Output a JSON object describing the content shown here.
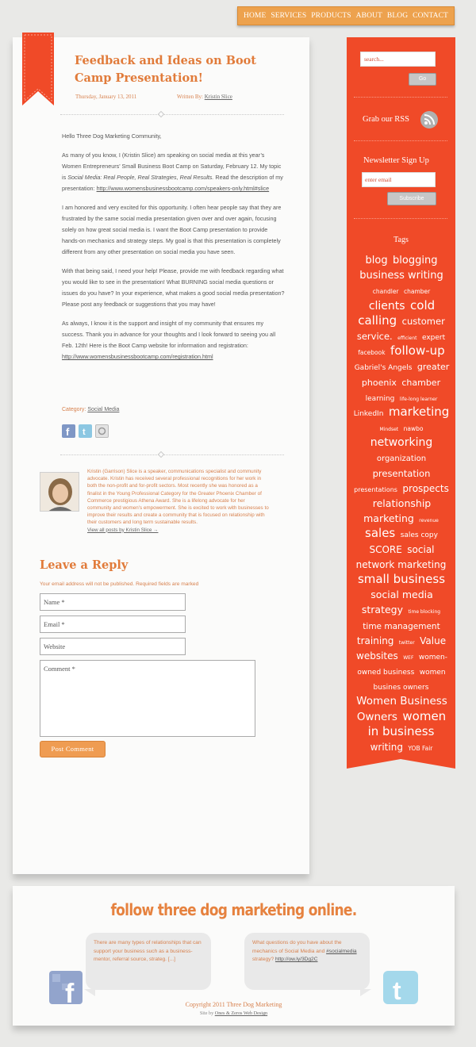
{
  "nav": {
    "items": [
      "HOME",
      "SERVICES",
      "PRODUCTS",
      "ABOUT",
      "BLOG",
      "CONTACT"
    ]
  },
  "post": {
    "title": "Feedback and Ideas on Boot Camp Presentation!",
    "date": "Thursday, January 13, 2011",
    "written_by_label": "Written By:",
    "author": "Kristin Slice",
    "p1": "Hello Three Dog Marketing Community,",
    "p2_a": "As many of you know, I (Kristin Slice) am speaking on social media at this year’s Women Entrepreneurs’ Small Business Boot Camp on Saturday, February 12. My topic is",
    "p2_topic": "Social Media: Real People, Real Strategies, Real Results.",
    "p2_b": "Read the description of my presentation:",
    "p2_link": "http://www.womensbusinessbootcamp.com/speakers-only.html#slice",
    "p3": "I am honored and very excited for this opportunity. I often hear people say that they are frustrated by the same social media presentation given over and over again, focusing solely on how great social media is. I want the Boot Camp presentation to provide hands-on mechanics and strategy steps. My goal is that this presentation is completely different from any other presentation on social media you have seen.",
    "p4": "With that being said, I need your help! Please, provide me with feedback regarding what you would like to see in the presentation! What BURNING social media questions or issues do you have? In your experience, what makes a good social media presentation? Please post any feedback or suggestions that you may have!",
    "p5": "As always, I know it is the support and insight of my community that ensures my success. Thank you in advance for your thoughts and I look forward to seeing you all Feb. 12th! Here is the Boot Camp website for information and registration:",
    "p5_link": "http://www.womensbusinessbootcamp.com/registration.html",
    "category_label": "Category:",
    "category": "Social Media"
  },
  "author_bio": {
    "text": "Kristin (Garrison) Slice is a speaker, communications specialist and community advocate. Kristin has received several professional recognitions for her work in both the non-profit and for-profit sectors. Most recently she was honored as a finalist in the Young Professional Category for the Greater Phoenix Chamber of Commerce prestigious Athena Award. She is a lifelong advocate for her community and women's empowerment. She is excited to work with businesses to improve their results and create a community that is focused on relationship with their customers and long term sustainable results.",
    "view_all": "View all posts by Kristin Slice →"
  },
  "reply": {
    "heading": "Leave a Reply",
    "note": "Your email address will not be published. Required fields are marked",
    "name_ph": "Name *",
    "email_ph": "Email *",
    "website_ph": "Website",
    "comment_ph": "Comment *",
    "submit": "Post Comment"
  },
  "sidebar": {
    "search_ph": "search...",
    "go": "Go",
    "rss": "Grab our RSS",
    "newsletter": "Newsletter Sign Up",
    "email_ph": "enter email",
    "subscribe": "Subscribe",
    "tags_heading": "Tags",
    "tags": [
      {
        "t": "blog",
        "s": 13
      },
      {
        "t": "blogging",
        "s": 13
      },
      {
        "t": "business writing",
        "s": 13
      },
      {
        "t": "chandler",
        "s": 7.5
      },
      {
        "t": "chamber",
        "s": 7.5
      },
      {
        "t": "clients",
        "s": 14
      },
      {
        "t": "cold calling",
        "s": 15
      },
      {
        "t": "customer service.",
        "s": 11.5
      },
      {
        "t": "efficient",
        "s": 6
      },
      {
        "t": "expert",
        "s": 9
      },
      {
        "t": "facebook",
        "s": 7.5
      },
      {
        "t": "follow-up",
        "s": 15
      },
      {
        "t": "Gabriel's Angels",
        "s": 9
      },
      {
        "t": "greater phoenix",
        "s": 11
      },
      {
        "t": "chamber",
        "s": 11
      },
      {
        "t": "learning",
        "s": 9
      },
      {
        "t": "life-long learner",
        "s": 6
      },
      {
        "t": "LinkedIn",
        "s": 9
      },
      {
        "t": "marketing",
        "s": 15
      },
      {
        "t": "Mindset",
        "s": 6
      },
      {
        "t": "nawbo",
        "s": 7.5
      },
      {
        "t": "networking",
        "s": 14
      },
      {
        "t": "organization",
        "s": 10
      },
      {
        "t": "presentation",
        "s": 11.5
      },
      {
        "t": "presentations",
        "s": 8
      },
      {
        "t": "prospects",
        "s": 12
      },
      {
        "t": "relationship marketing",
        "s": 12.5
      },
      {
        "t": "revenue",
        "s": 6
      },
      {
        "t": "sales",
        "s": 15
      },
      {
        "t": "sales copy",
        "s": 9
      },
      {
        "t": "SCORE",
        "s": 12
      },
      {
        "t": "social network marketing",
        "s": 12
      },
      {
        "t": "small business",
        "s": 15
      },
      {
        "t": "social media strategy",
        "s": 12.5
      },
      {
        "t": "time blocking",
        "s": 6
      },
      {
        "t": "time management",
        "s": 10.5
      },
      {
        "t": "training",
        "s": 12
      },
      {
        "t": "twitter",
        "s": 6
      },
      {
        "t": "Value",
        "s": 12
      },
      {
        "t": "websites",
        "s": 12
      },
      {
        "t": "WEF",
        "s": 6
      },
      {
        "t": "women-owned business",
        "s": 9
      },
      {
        "t": "women busines owners",
        "s": 9
      },
      {
        "t": "Women Business Owners",
        "s": 13.5
      },
      {
        "t": "women in business",
        "s": 15
      },
      {
        "t": "writing",
        "s": 12
      },
      {
        "t": "YOB Fair",
        "s": 7.5
      }
    ]
  },
  "footer": {
    "title": "follow three dog marketing online.",
    "fb_text": "There are many types of relationships that can support your business such as a business-mentor, referral source, strateg.",
    "fb_more": "[...]",
    "tw_text_a": "What questions do you have about the mechanics of Social Media and",
    "tw_hashtag": "#socialmedia",
    "tw_text_b": "strategy?",
    "tw_link": "http://ow.ly/3Dg2C",
    "copyright": "Copyright 2011 Three Dog Marketing",
    "site_by": "Site by",
    "site_by_name": "Ones & Zeros Web Design"
  },
  "colors": {
    "accent": "#e17b3a",
    "ribbon": "#f04a28",
    "nav": "#eda24e"
  }
}
